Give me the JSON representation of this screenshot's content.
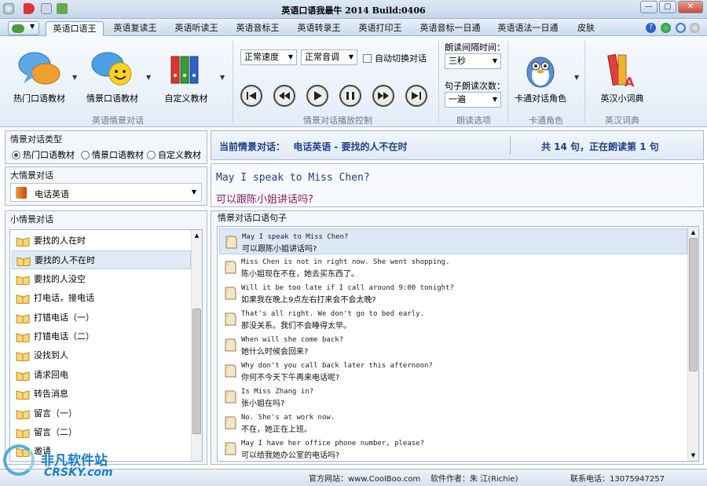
{
  "window": {
    "title": "英语口语我最牛 2014 Build:0406",
    "min_glyph": "—",
    "max_glyph": "▢",
    "close_glyph": "✕"
  },
  "tabs": [
    {
      "label": "英语口语王"
    },
    {
      "label": "英语复读王"
    },
    {
      "label": "英语听读王"
    },
    {
      "label": "英语音标王"
    },
    {
      "label": "英语转录王"
    },
    {
      "label": "英语打印王"
    },
    {
      "label": "英语音标一日通"
    },
    {
      "label": "英语语法一日通"
    },
    {
      "label": "皮肤"
    }
  ],
  "ribbon": {
    "scene_group": {
      "label": "英语情景对话",
      "btn_hot": "热门口语教材",
      "btn_scene": "情景口语教材",
      "btn_custom": "自定义教材"
    },
    "play_group": {
      "label": "情景对话播放控制",
      "speed": "正常速度",
      "tone": "正常音调",
      "auto_switch": "自动切换对话"
    },
    "read_group": {
      "label": "朗读选项",
      "interval_label": "朗读间隔时间：",
      "interval_value": "三秒",
      "times_label": "句子朗读次数：",
      "times_value": "一遍"
    },
    "role_group": {
      "label": "卡通角色",
      "btn": "卡通对话角色"
    },
    "dict_group": {
      "label": "英汉词典",
      "btn": "英汉小词典"
    }
  },
  "left": {
    "type_title": "情景对话类型",
    "radios": [
      {
        "label": "热门口语教材",
        "checked": true
      },
      {
        "label": "情景口语教材",
        "checked": false
      },
      {
        "label": "自定义教材",
        "checked": false
      }
    ],
    "big_title": "大情景对话",
    "big_value": "电话英语",
    "small_title": "小情景对话",
    "small_items": [
      {
        "label": "要找的人在时"
      },
      {
        "label": "要找的人不在时"
      },
      {
        "label": "要找的人没空"
      },
      {
        "label": "打电话，接电话"
      },
      {
        "label": "打错电话（一）"
      },
      {
        "label": "打错电话（二）"
      },
      {
        "label": "没找到人"
      },
      {
        "label": "请求回电"
      },
      {
        "label": "转告消息"
      },
      {
        "label": "留言（一）"
      },
      {
        "label": "留言（二）"
      },
      {
        "label": "邀请"
      }
    ],
    "selected_index": 1
  },
  "status_line": {
    "current_label": "当前情景对话：",
    "current_value": "电话英语 - 要找的人不在时",
    "progress_text": "共 14 句，正在朗读第 1 句"
  },
  "current_sentence": {
    "en": "May I speak to Miss Chen?",
    "zh": "可以跟陈小姐讲话吗?"
  },
  "sentences_title": "情景对话口语句子",
  "sentences": [
    {
      "en": "May I speak to Miss Chen?",
      "zh": "可以跟陈小姐讲话吗?"
    },
    {
      "en": "Miss Chen is not in right now. She went shopping.",
      "zh": "陈小姐现在不在，她去买东西了。"
    },
    {
      "en": "Will it be too late if I call around 9:00 tonight?",
      "zh": "如果我在晚上9点左右打来会不会太晚?"
    },
    {
      "en": "That's all right. We don't go to bed early.",
      "zh": "那没关系。我们不会睡得太早。"
    },
    {
      "en": "When will she come back?",
      "zh": "她什么时候会回来?"
    },
    {
      "en": "Why don't you call back later this afternoon?",
      "zh": "你何不今天下午再来电话呢?"
    },
    {
      "en": "Is Miss Zhang in?",
      "zh": "张小姐在吗?"
    },
    {
      "en": "No. She's at work now.",
      "zh": "不在，她正在上班。"
    },
    {
      "en": "May I have her office phone number, please?",
      "zh": "可以给我她办公室的电话吗?"
    }
  ],
  "statusbar": {
    "website": "官方网站：www.CoolBoo.com",
    "author": "软件作者：朱 江(Richie)",
    "phone": "联系电话：13075947257"
  },
  "watermark": {
    "cn": "非凡软件站",
    "en": "CRSKY.com"
  },
  "colors": {
    "accent": "#1f3f8a",
    "title_text": "#243f7a",
    "zh_highlight": "#8a1a6a"
  }
}
